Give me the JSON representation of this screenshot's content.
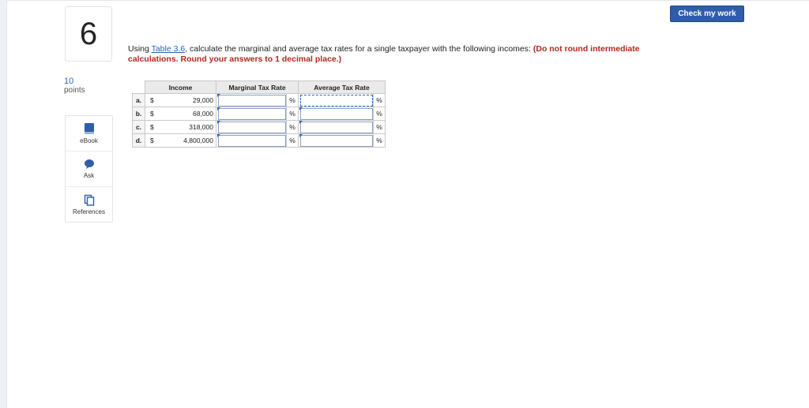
{
  "header": {
    "check_label": "Check my work"
  },
  "question": {
    "number": "6",
    "points_value": "10",
    "points_label": "points",
    "text_pre": "Using ",
    "table_link": "Table 3.6",
    "text_post": ", calculate the marginal and average tax rates for a single taxpayer with the following incomes: ",
    "instruction": "(Do not round intermediate calculations. Round your answers to 1 decimal place.)"
  },
  "tools": [
    {
      "label": "eBook",
      "icon": "book-icon"
    },
    {
      "label": "Ask",
      "icon": "chat-bubble-icon"
    },
    {
      "label": "References",
      "icon": "references-icon"
    }
  ],
  "table": {
    "headers": {
      "income": "Income",
      "marginal": "Marginal Tax Rate",
      "average": "Average Tax Rate"
    },
    "rows": [
      {
        "letter": "a.",
        "dollar": "$",
        "amount": "29,000",
        "marginal": "",
        "average": "",
        "pct": "%"
      },
      {
        "letter": "b.",
        "dollar": "$",
        "amount": "68,000",
        "marginal": "",
        "average": "",
        "pct": "%"
      },
      {
        "letter": "c.",
        "dollar": "$",
        "amount": "318,000",
        "marginal": "",
        "average": "",
        "pct": "%"
      },
      {
        "letter": "d.",
        "dollar": "$",
        "amount": "4,800,000",
        "marginal": "",
        "average": "",
        "pct": "%"
      }
    ]
  },
  "colors": {
    "accent": "#2f5da8",
    "link": "#2b63b5",
    "warning": "#b3261e"
  }
}
